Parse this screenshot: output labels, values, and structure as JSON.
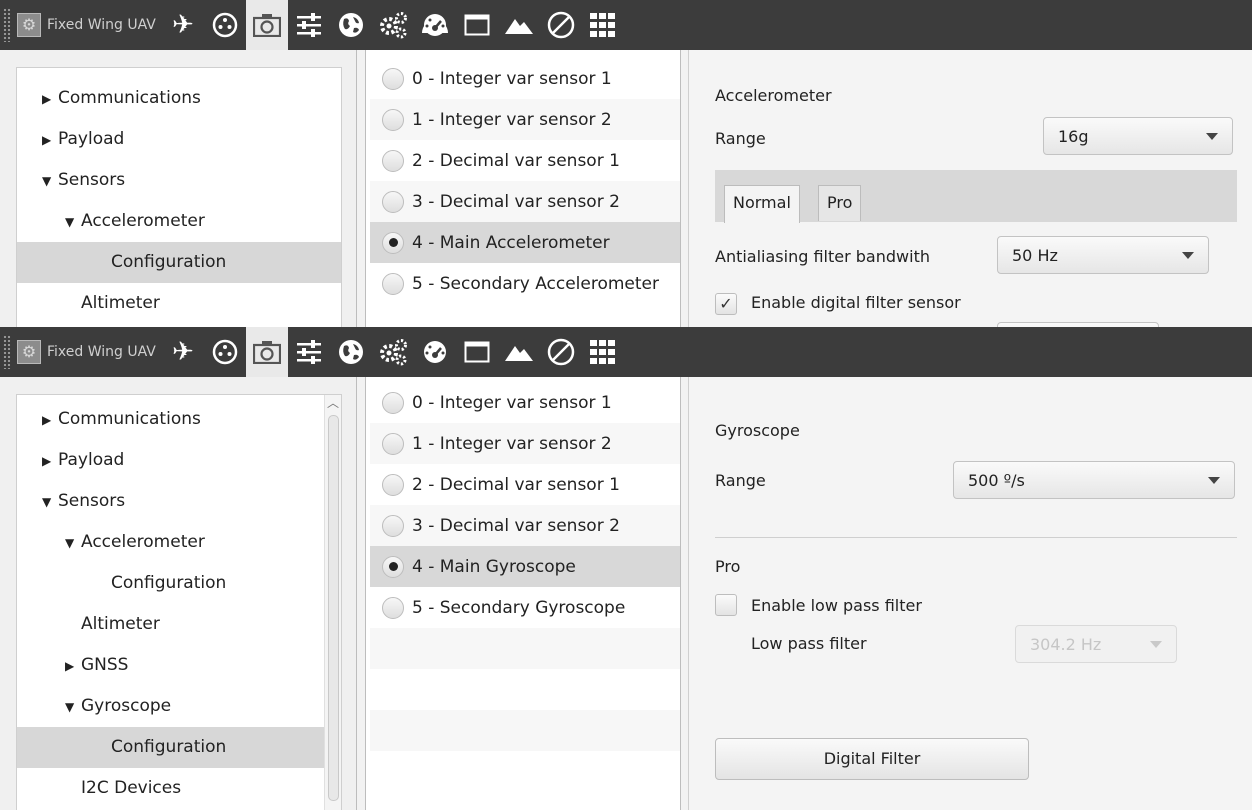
{
  "toolbar": {
    "title": "Fixed Wing UAV",
    "icons": [
      "airplane-icon",
      "joystick-icon",
      "camera-icon",
      "sliders-icon",
      "globe-icon",
      "gears-icon",
      "gauge-icon",
      "window-icon",
      "mountain-icon",
      "prohibited-icon",
      "grid-icon"
    ],
    "active_icon": "camera-icon"
  },
  "panel1": {
    "tree": [
      {
        "label": "Communications",
        "toggle": "▶",
        "level": 1
      },
      {
        "label": "Payload",
        "toggle": "▶",
        "level": 1
      },
      {
        "label": "Sensors",
        "toggle": "▼",
        "level": 1
      },
      {
        "label": "Accelerometer",
        "toggle": "▼",
        "level": 2
      },
      {
        "label": "Configuration",
        "toggle": "",
        "level": 3,
        "selected": true
      },
      {
        "label": "Altimeter",
        "toggle": "",
        "level": 2
      }
    ],
    "list": [
      "0 - Integer var sensor 1",
      "1 - Integer var sensor 2",
      "2 - Decimal var sensor 1",
      "3 - Decimal var sensor 2",
      "4 - Main Accelerometer",
      "5 - Secondary Accelerometer"
    ],
    "list_selected": 4,
    "config": {
      "section_title": "Accelerometer",
      "range_label": "Range",
      "range_value": "16g",
      "tabs": [
        "Normal",
        "Pro"
      ],
      "active_tab": "Normal",
      "aa_label": "Antialiasing filter bandwith",
      "aa_value": "50 Hz",
      "digital_filter_label": "Enable digital filter sensor",
      "digital_filter_checked": true,
      "check_mark": "✓"
    }
  },
  "panel2": {
    "tree": [
      {
        "label": "Communications",
        "toggle": "▶",
        "level": 1
      },
      {
        "label": "Payload",
        "toggle": "▶",
        "level": 1
      },
      {
        "label": "Sensors",
        "toggle": "▼",
        "level": 1
      },
      {
        "label": "Accelerometer",
        "toggle": "▼",
        "level": 2
      },
      {
        "label": "Configuration",
        "toggle": "",
        "level": 3
      },
      {
        "label": "Altimeter",
        "toggle": "",
        "level": 2
      },
      {
        "label": "GNSS",
        "toggle": "▶",
        "level": 2
      },
      {
        "label": "Gyroscope",
        "toggle": "▼",
        "level": 2
      },
      {
        "label": "Configuration",
        "toggle": "",
        "level": 3,
        "selected": true
      },
      {
        "label": "I2C Devices",
        "toggle": "",
        "level": 2
      }
    ],
    "list": [
      "0 - Integer var sensor 1",
      "1 - Integer var sensor 2",
      "2 - Decimal var sensor 1",
      "3 - Decimal var sensor 2",
      "4 - Main Gyroscope",
      "5 - Secondary Gyroscope"
    ],
    "list_selected": 4,
    "config": {
      "section_title": "Gyroscope",
      "range_label": "Range",
      "range_value": "500 º/s",
      "pro_title": "Pro",
      "lowpass_enable_label": "Enable low pass filter",
      "lowpass_enabled": false,
      "lowpass_label": "Low pass filter",
      "lowpass_value": "304.2 Hz",
      "digital_filter_button": "Digital Filter"
    }
  }
}
